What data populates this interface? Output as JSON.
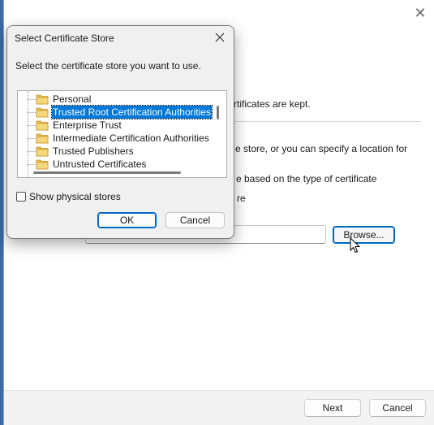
{
  "wizard": {
    "close_glyph": "✕",
    "text_line_1": "rtificates are kept.",
    "text_line_2": "e store, or you can specify a location for",
    "text_line_3": "e based on the type of certificate",
    "text_line_4": "re",
    "path_value": "",
    "browse_label": "Browse...",
    "next_label": "Next",
    "cancel_label": "Cancel"
  },
  "dialog": {
    "title": "Select Certificate Store",
    "instruction": "Select the certificate store you want to use.",
    "tree_items": [
      {
        "label": "Personal",
        "selected": false
      },
      {
        "label": "Trusted Root Certification Authorities",
        "selected": true
      },
      {
        "label": "Enterprise Trust",
        "selected": false
      },
      {
        "label": "Intermediate Certification Authorities",
        "selected": false
      },
      {
        "label": "Trusted Publishers",
        "selected": false
      },
      {
        "label": "Untrusted Certificates",
        "selected": false
      }
    ],
    "show_physical_label": "Show physical stores",
    "show_physical_checked": false,
    "ok_label": "OK",
    "cancel_label": "Cancel"
  },
  "colors": {
    "selection": "#0078d7",
    "accent": "#0067c0",
    "folder": "#f5d77e"
  }
}
